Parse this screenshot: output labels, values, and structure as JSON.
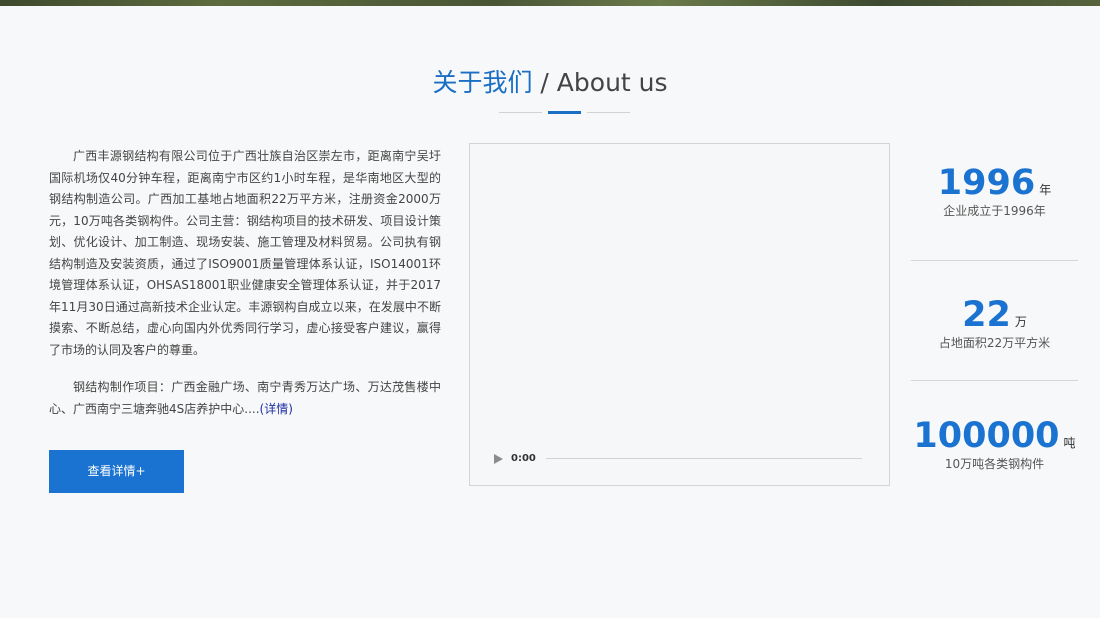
{
  "header": {
    "title_cn": "关于我们",
    "title_sep": " / ",
    "title_en": "About us"
  },
  "intro": {
    "paragraph1": "广西丰源钢结构有限公司位于广西壮族自治区崇左市，距离南宁吴圩国际机场仅40分钟车程，距离南宁市区约1小时车程，是华南地区大型的钢结构制造公司。广西加工基地占地面积22万平方米，注册资金2000万元，10万吨各类钢构件。公司主营：钢结构项目的技术研发、项目设计策划、优化设计、加工制造、现场安装、施工管理及材料贸易。公司执有钢结构制造及安装资质，通过了ISO9001质量管理体系认证，ISO14001环境管理体系认证，OHSAS18001职业健康安全管理体系认证，并于2017年11月30日通过高新技术企业认定。丰源钢构自成立以来，在发展中不断摸索、不断总结，虚心向国内外优秀同行学习，虚心接受客户建议，赢得了市场的认同及客户的尊重。",
    "paragraph2": "钢结构制作项目：广西金融广场、南宁青秀万达广场、万达茂售楼中心、广西南宁三塘奔驰4S店养护中心....",
    "more_link": "(详情)"
  },
  "buttons": {
    "detail": "查看详情+"
  },
  "video": {
    "time": "0:00",
    "progress": 0
  },
  "stats": [
    {
      "number": "1996",
      "unit": "年",
      "caption": "企业成立于1996年"
    },
    {
      "number": "22",
      "unit": "万",
      "caption": "占地面积22万平方米"
    },
    {
      "number": "100000",
      "unit": "吨",
      "caption": "10万吨各类钢构件"
    }
  ],
  "colors": {
    "accent": "#1a73d0",
    "title": "#1a6fc4",
    "background": "#f7f8f9"
  },
  "icons": {
    "play": "play-icon"
  }
}
